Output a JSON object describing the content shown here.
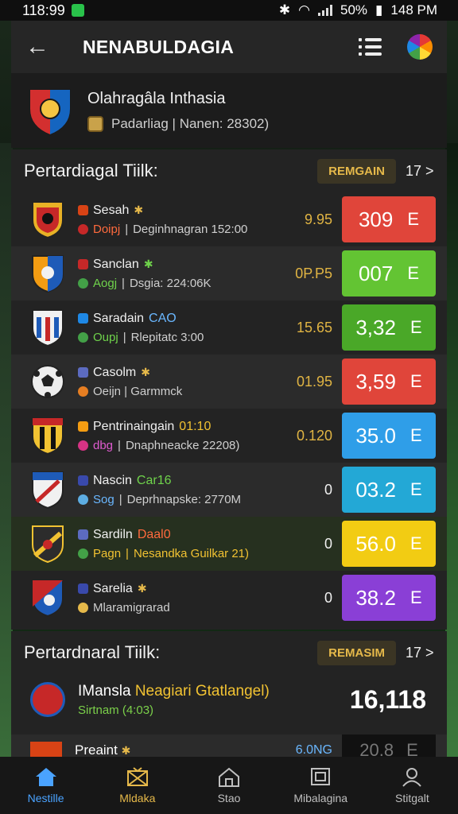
{
  "status_bar": {
    "time": "118:99",
    "battery": "50%",
    "clock": "148 PM"
  },
  "app_bar": {
    "title": "NENABULDAGIA",
    "back_icon": "arrow-left-icon",
    "menu_icon": "list-icon",
    "stats_icon": "pie-chart-icon"
  },
  "team_header": {
    "name": "Olahragâla Inthasia",
    "subtitle": "Padarliag | Nanen: 28302)"
  },
  "section1": {
    "title": "Pertardiagal Tiilk:",
    "remain_label": "REMGAIN",
    "nav_label": "17 >",
    "rows": [
      {
        "title": "Sesah",
        "title_extra": "",
        "sub_highlight": "Doipj",
        "sub": "Deginhnagran 152:00",
        "value": "9.95",
        "odd": "309",
        "odd_suffix": "E",
        "odd_color": "#e0453a"
      },
      {
        "title": "Sanclan",
        "title_extra": "",
        "sub_highlight": "Aogj",
        "sub": "Dsgia: 224:06K",
        "value": "0P.P5",
        "odd": "007",
        "odd_suffix": "E",
        "odd_color": "#63c433"
      },
      {
        "title": "Saradain",
        "title_extra": "CAO",
        "sub_highlight": "Oupj",
        "sub": "Rlepitatc 3:00",
        "value": "15.65",
        "odd": "3,32",
        "odd_suffix": "E",
        "odd_color": "#4aa828"
      },
      {
        "title": "Casolm",
        "title_extra": "",
        "sub_highlight": "",
        "sub": "Oeijn | Garmmck",
        "value": "01.95",
        "odd": "3,59",
        "odd_suffix": "E",
        "odd_color": "#e0453a"
      },
      {
        "title": "Pentrinaingain",
        "title_extra": "01:10",
        "sub_highlight": "dbg",
        "sub": "Dnaphneacke 22208)",
        "value": "0.120",
        "odd": "35.0",
        "odd_suffix": "E",
        "odd_color": "#2f9ee8"
      },
      {
        "title": "Nascin",
        "title_extra": "Car16",
        "sub_highlight": "Sog",
        "sub": "Deprhnapske: 2770M",
        "value": "0",
        "odd": "03.2",
        "odd_suffix": "E",
        "odd_color": "#23a8d6"
      },
      {
        "title": "Sardiln",
        "title_extra": "Daal0",
        "sub_highlight": "Pagn",
        "sub": "Nesandka Guilkar 21)",
        "value": "0",
        "odd": "56.0",
        "odd_suffix": "E",
        "odd_color": "#f2cc13"
      },
      {
        "title": "Sarelia",
        "title_extra": "",
        "sub_highlight": "",
        "sub": "Mlaramigrarad",
        "value": "0",
        "odd": "38.2",
        "odd_suffix": "E",
        "odd_color": "#8a3fd6"
      }
    ]
  },
  "section2": {
    "title": "Pertardnaral Tiilk:",
    "remain_label": "REMASIM",
    "nav_label": "17 >",
    "match": {
      "name": "IMansla",
      "name_extra": "Neagiari Gtatlangel)",
      "sub": "Sirtnam (4:03)",
      "score": "16,118"
    },
    "mini": {
      "title": "Preaint",
      "value": "6.0NG",
      "odd": "20.8",
      "odd_suffix": "E"
    }
  },
  "bottom_nav": [
    {
      "label": "Nestille",
      "icon": "home-icon"
    },
    {
      "label": "Mldaka",
      "icon": "bracket-icon"
    },
    {
      "label": "Stao",
      "icon": "house-outline-icon"
    },
    {
      "label": "Mibalagina",
      "icon": "gallery-icon"
    },
    {
      "label": "Stitgalt",
      "icon": "user-icon"
    }
  ]
}
